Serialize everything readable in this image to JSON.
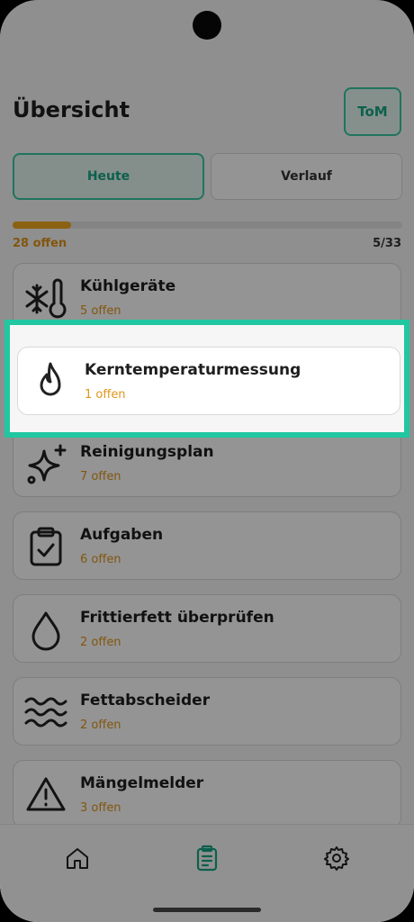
{
  "header": {
    "title": "Übersicht",
    "user_initials": "ToM"
  },
  "tabs": [
    {
      "label": "Heute",
      "active": true
    },
    {
      "label": "Verlauf",
      "active": false
    }
  ],
  "progress": {
    "open_label": "28 offen",
    "count_label": "5/33",
    "fraction": 0.15
  },
  "categories": [
    {
      "name": "Kühlgeräte",
      "open": "5 offen",
      "icon": "snowflake-thermometer-icon"
    },
    {
      "name": "Kerntemperaturmessung",
      "open": "1 offen",
      "icon": "flame-icon",
      "highlighted": true
    },
    {
      "name": "Reinigungsplan",
      "open": "7 offen",
      "icon": "sparkle-icon"
    },
    {
      "name": "Aufgaben",
      "open": "6 offen",
      "icon": "clipboard-check-icon"
    },
    {
      "name": "Frittierfett überprüfen",
      "open": "2 offen",
      "icon": "droplet-icon"
    },
    {
      "name": "Fettabscheider",
      "open": "2 offen",
      "icon": "waves-icon"
    },
    {
      "name": "Mängelmelder",
      "open": "3 offen",
      "icon": "warning-icon"
    }
  ],
  "bottom_nav": [
    {
      "name": "home-icon",
      "active": false
    },
    {
      "name": "clipboard-list-icon",
      "active": true
    },
    {
      "name": "gear-icon",
      "active": false
    }
  ],
  "colors": {
    "accent": "#20c7a0",
    "warning": "#e0951a",
    "highlight_border": "#20c7a0"
  }
}
